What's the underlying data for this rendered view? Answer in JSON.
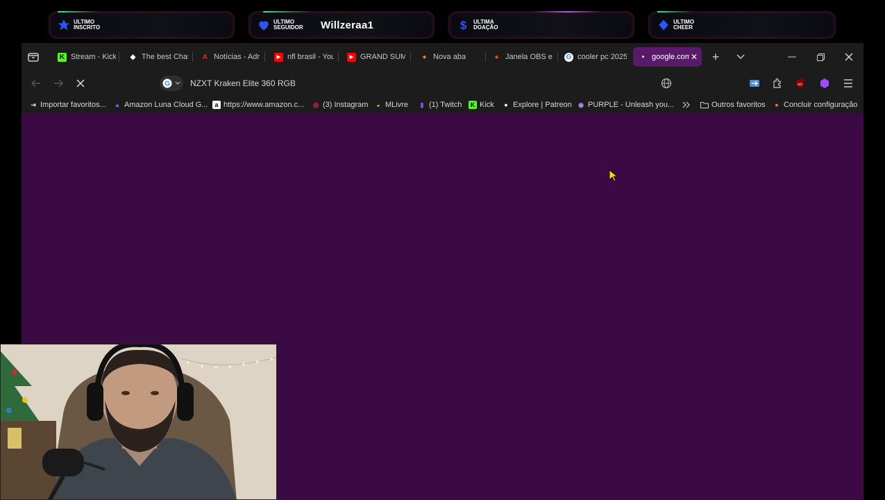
{
  "alerts": [
    {
      "label_line1": "ULTIMO",
      "label_line2": "INSCRITO",
      "value": "",
      "icon": "star-icon",
      "color": "#2b55ff"
    },
    {
      "label_line1": "ULTIMO",
      "label_line2": "SEGUIDOR",
      "value": "Willzeraa1",
      "icon": "heart-icon",
      "color": "#2b55ff"
    },
    {
      "label_line1": "ULTIMA",
      "label_line2": "DOAÇÃO",
      "value": "",
      "icon": "dollar-icon",
      "color": "#2b55ff"
    },
    {
      "label_line1": "ULTIMO",
      "label_line2": "CHEER",
      "value": "",
      "icon": "diamond-icon",
      "color": "#2b55ff"
    }
  ],
  "tabs": [
    {
      "title": "Stream - Kick",
      "icon": "kick-icon",
      "fav": "K",
      "fav_color": "#53fc18"
    },
    {
      "title": "The best Chat",
      "icon": "chat-icon",
      "fav": "◆",
      "fav_color": "#ffffff"
    },
    {
      "title": "Notícias - Adr",
      "icon": "adrenaline-icon",
      "fav": "A",
      "fav_color": "#e0301e"
    },
    {
      "title": "nfl brasil - You",
      "icon": "youtube-icon",
      "fav": "▶",
      "fav_color": "#ff0000"
    },
    {
      "title": "GRAND SUMO",
      "icon": "youtube-icon",
      "fav": "▶",
      "fav_color": "#ff0000"
    },
    {
      "title": "Nova aba",
      "icon": "firefox-icon",
      "fav": "●",
      "fav_color": "#ff7139"
    },
    {
      "title": "Janela OBS e c",
      "icon": "reddit-icon",
      "fav": "●",
      "fav_color": "#ff4500"
    },
    {
      "title": "cooler pc 2025",
      "icon": "google-icon",
      "fav": "G",
      "fav_color": "#4285f4"
    },
    {
      "title": "google.com",
      "icon": "loading-icon",
      "fav": "•",
      "fav_color": "#ffffff",
      "active": true
    }
  ],
  "toolbar": {
    "query": "NZXT Kraken Elite 360 RGB"
  },
  "bookmarks": [
    {
      "label": "Importar favoritos...",
      "icon": "import-icon",
      "fav": "⇥",
      "fav_color": "#d8d8d8"
    },
    {
      "label": "Amazon Luna Cloud G...",
      "icon": "amazon-luna-icon",
      "fav": "▲",
      "fav_color": "#8a4dff"
    },
    {
      "label": "https://www.amazon.c...",
      "icon": "amazon-icon",
      "fav": "a",
      "fav_color": "#ffffff"
    },
    {
      "label": "(3) Instagram",
      "icon": "instagram-icon",
      "fav": "◎",
      "fav_color": "#e1306c"
    },
    {
      "label": "MLivre",
      "icon": "mercadolivre-icon",
      "fav": "◒",
      "fav_color": "#ffe600"
    },
    {
      "label": "(1) Twitch",
      "icon": "twitch-icon",
      "fav": "▮",
      "fav_color": "#9146ff"
    },
    {
      "label": "Kick",
      "icon": "kick-icon",
      "fav": "K",
      "fav_color": "#53fc18"
    },
    {
      "label": "Explore | Patreon",
      "icon": "patreon-icon",
      "fav": "●",
      "fav_color": "#ffffff"
    },
    {
      "label": "PURPLE - Unleash you...",
      "icon": "purple-icon",
      "fav": "◉",
      "fav_color": "#b388ff"
    },
    {
      "label": "Outros favoritos",
      "icon": "folder-icon",
      "fav": "▭",
      "fav_color": "#d8d8d8"
    },
    {
      "label": "Concluir configuração",
      "icon": "firefox-icon",
      "fav": "●",
      "fav_color": "#ff7139"
    }
  ]
}
